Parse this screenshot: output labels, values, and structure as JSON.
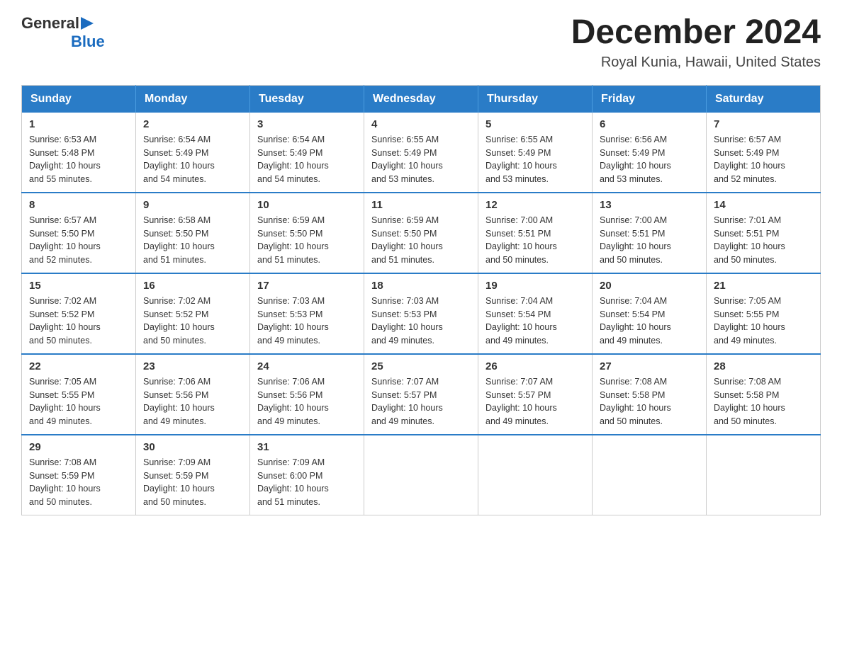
{
  "header": {
    "logo": {
      "general_text": "General",
      "blue_text": "Blue"
    },
    "title": "December 2024",
    "location": "Royal Kunia, Hawaii, United States"
  },
  "calendar": {
    "days_of_week": [
      "Sunday",
      "Monday",
      "Tuesday",
      "Wednesday",
      "Thursday",
      "Friday",
      "Saturday"
    ],
    "weeks": [
      [
        {
          "day": "1",
          "sunrise": "6:53 AM",
          "sunset": "5:48 PM",
          "daylight": "10 hours and 55 minutes."
        },
        {
          "day": "2",
          "sunrise": "6:54 AM",
          "sunset": "5:49 PM",
          "daylight": "10 hours and 54 minutes."
        },
        {
          "day": "3",
          "sunrise": "6:54 AM",
          "sunset": "5:49 PM",
          "daylight": "10 hours and 54 minutes."
        },
        {
          "day": "4",
          "sunrise": "6:55 AM",
          "sunset": "5:49 PM",
          "daylight": "10 hours and 53 minutes."
        },
        {
          "day": "5",
          "sunrise": "6:55 AM",
          "sunset": "5:49 PM",
          "daylight": "10 hours and 53 minutes."
        },
        {
          "day": "6",
          "sunrise": "6:56 AM",
          "sunset": "5:49 PM",
          "daylight": "10 hours and 53 minutes."
        },
        {
          "day": "7",
          "sunrise": "6:57 AM",
          "sunset": "5:49 PM",
          "daylight": "10 hours and 52 minutes."
        }
      ],
      [
        {
          "day": "8",
          "sunrise": "6:57 AM",
          "sunset": "5:50 PM",
          "daylight": "10 hours and 52 minutes."
        },
        {
          "day": "9",
          "sunrise": "6:58 AM",
          "sunset": "5:50 PM",
          "daylight": "10 hours and 51 minutes."
        },
        {
          "day": "10",
          "sunrise": "6:59 AM",
          "sunset": "5:50 PM",
          "daylight": "10 hours and 51 minutes."
        },
        {
          "day": "11",
          "sunrise": "6:59 AM",
          "sunset": "5:50 PM",
          "daylight": "10 hours and 51 minutes."
        },
        {
          "day": "12",
          "sunrise": "7:00 AM",
          "sunset": "5:51 PM",
          "daylight": "10 hours and 50 minutes."
        },
        {
          "day": "13",
          "sunrise": "7:00 AM",
          "sunset": "5:51 PM",
          "daylight": "10 hours and 50 minutes."
        },
        {
          "day": "14",
          "sunrise": "7:01 AM",
          "sunset": "5:51 PM",
          "daylight": "10 hours and 50 minutes."
        }
      ],
      [
        {
          "day": "15",
          "sunrise": "7:02 AM",
          "sunset": "5:52 PM",
          "daylight": "10 hours and 50 minutes."
        },
        {
          "day": "16",
          "sunrise": "7:02 AM",
          "sunset": "5:52 PM",
          "daylight": "10 hours and 50 minutes."
        },
        {
          "day": "17",
          "sunrise": "7:03 AM",
          "sunset": "5:53 PM",
          "daylight": "10 hours and 49 minutes."
        },
        {
          "day": "18",
          "sunrise": "7:03 AM",
          "sunset": "5:53 PM",
          "daylight": "10 hours and 49 minutes."
        },
        {
          "day": "19",
          "sunrise": "7:04 AM",
          "sunset": "5:54 PM",
          "daylight": "10 hours and 49 minutes."
        },
        {
          "day": "20",
          "sunrise": "7:04 AM",
          "sunset": "5:54 PM",
          "daylight": "10 hours and 49 minutes."
        },
        {
          "day": "21",
          "sunrise": "7:05 AM",
          "sunset": "5:55 PM",
          "daylight": "10 hours and 49 minutes."
        }
      ],
      [
        {
          "day": "22",
          "sunrise": "7:05 AM",
          "sunset": "5:55 PM",
          "daylight": "10 hours and 49 minutes."
        },
        {
          "day": "23",
          "sunrise": "7:06 AM",
          "sunset": "5:56 PM",
          "daylight": "10 hours and 49 minutes."
        },
        {
          "day": "24",
          "sunrise": "7:06 AM",
          "sunset": "5:56 PM",
          "daylight": "10 hours and 49 minutes."
        },
        {
          "day": "25",
          "sunrise": "7:07 AM",
          "sunset": "5:57 PM",
          "daylight": "10 hours and 49 minutes."
        },
        {
          "day": "26",
          "sunrise": "7:07 AM",
          "sunset": "5:57 PM",
          "daylight": "10 hours and 49 minutes."
        },
        {
          "day": "27",
          "sunrise": "7:08 AM",
          "sunset": "5:58 PM",
          "daylight": "10 hours and 50 minutes."
        },
        {
          "day": "28",
          "sunrise": "7:08 AM",
          "sunset": "5:58 PM",
          "daylight": "10 hours and 50 minutes."
        }
      ],
      [
        {
          "day": "29",
          "sunrise": "7:08 AM",
          "sunset": "5:59 PM",
          "daylight": "10 hours and 50 minutes."
        },
        {
          "day": "30",
          "sunrise": "7:09 AM",
          "sunset": "5:59 PM",
          "daylight": "10 hours and 50 minutes."
        },
        {
          "day": "31",
          "sunrise": "7:09 AM",
          "sunset": "6:00 PM",
          "daylight": "10 hours and 51 minutes."
        },
        {
          "day": "",
          "sunrise": "",
          "sunset": "",
          "daylight": ""
        },
        {
          "day": "",
          "sunrise": "",
          "sunset": "",
          "daylight": ""
        },
        {
          "day": "",
          "sunrise": "",
          "sunset": "",
          "daylight": ""
        },
        {
          "day": "",
          "sunrise": "",
          "sunset": "",
          "daylight": ""
        }
      ]
    ],
    "sunrise_label": "Sunrise:",
    "sunset_label": "Sunset:",
    "daylight_label": "Daylight:"
  }
}
